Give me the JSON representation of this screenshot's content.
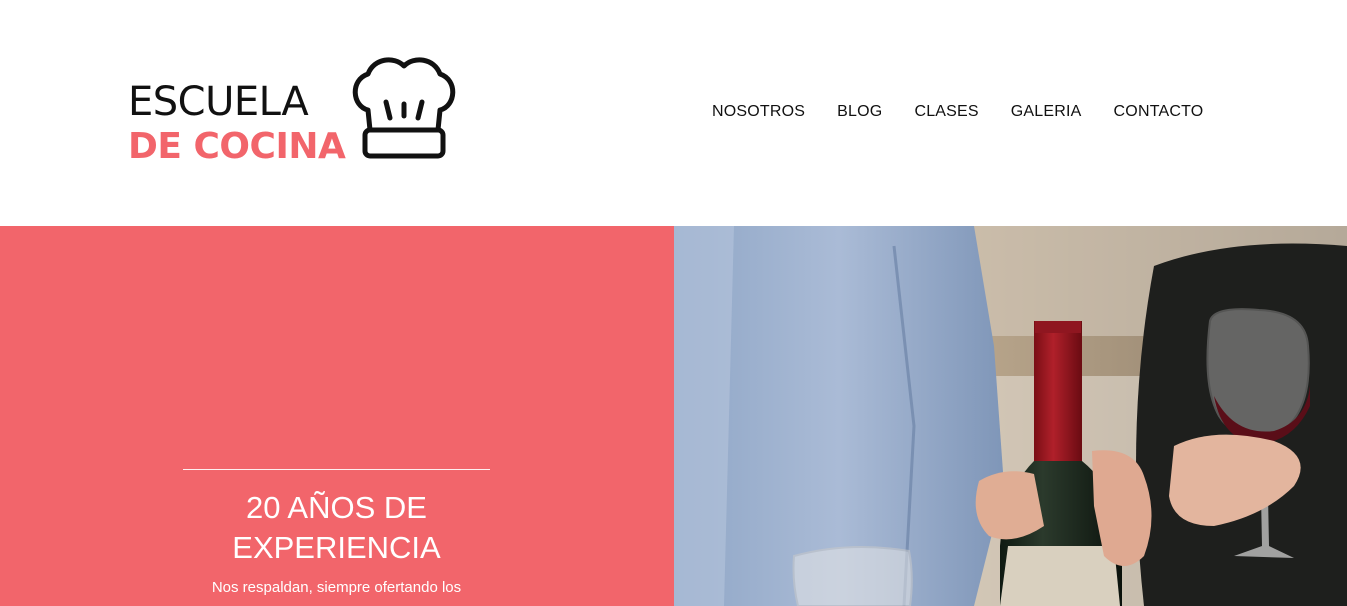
{
  "header": {
    "logo": {
      "line1": "ESCUELA",
      "line2": "DE COCINA",
      "icon": "chef-hat-icon"
    },
    "nav": [
      {
        "label": "NOSOTROS"
      },
      {
        "label": "BLOG"
      },
      {
        "label": "CLASES"
      },
      {
        "label": "GALERIA"
      },
      {
        "label": "CONTACTO"
      }
    ]
  },
  "hero": {
    "title": "20 AÑOS DE EXPERIENCIA",
    "text": "Nos respaldan, siempre ofertando los",
    "image": "wine-bottle-photo"
  },
  "colors": {
    "accent": "#f2656b",
    "text": "#111111",
    "background": "#ffffff"
  }
}
